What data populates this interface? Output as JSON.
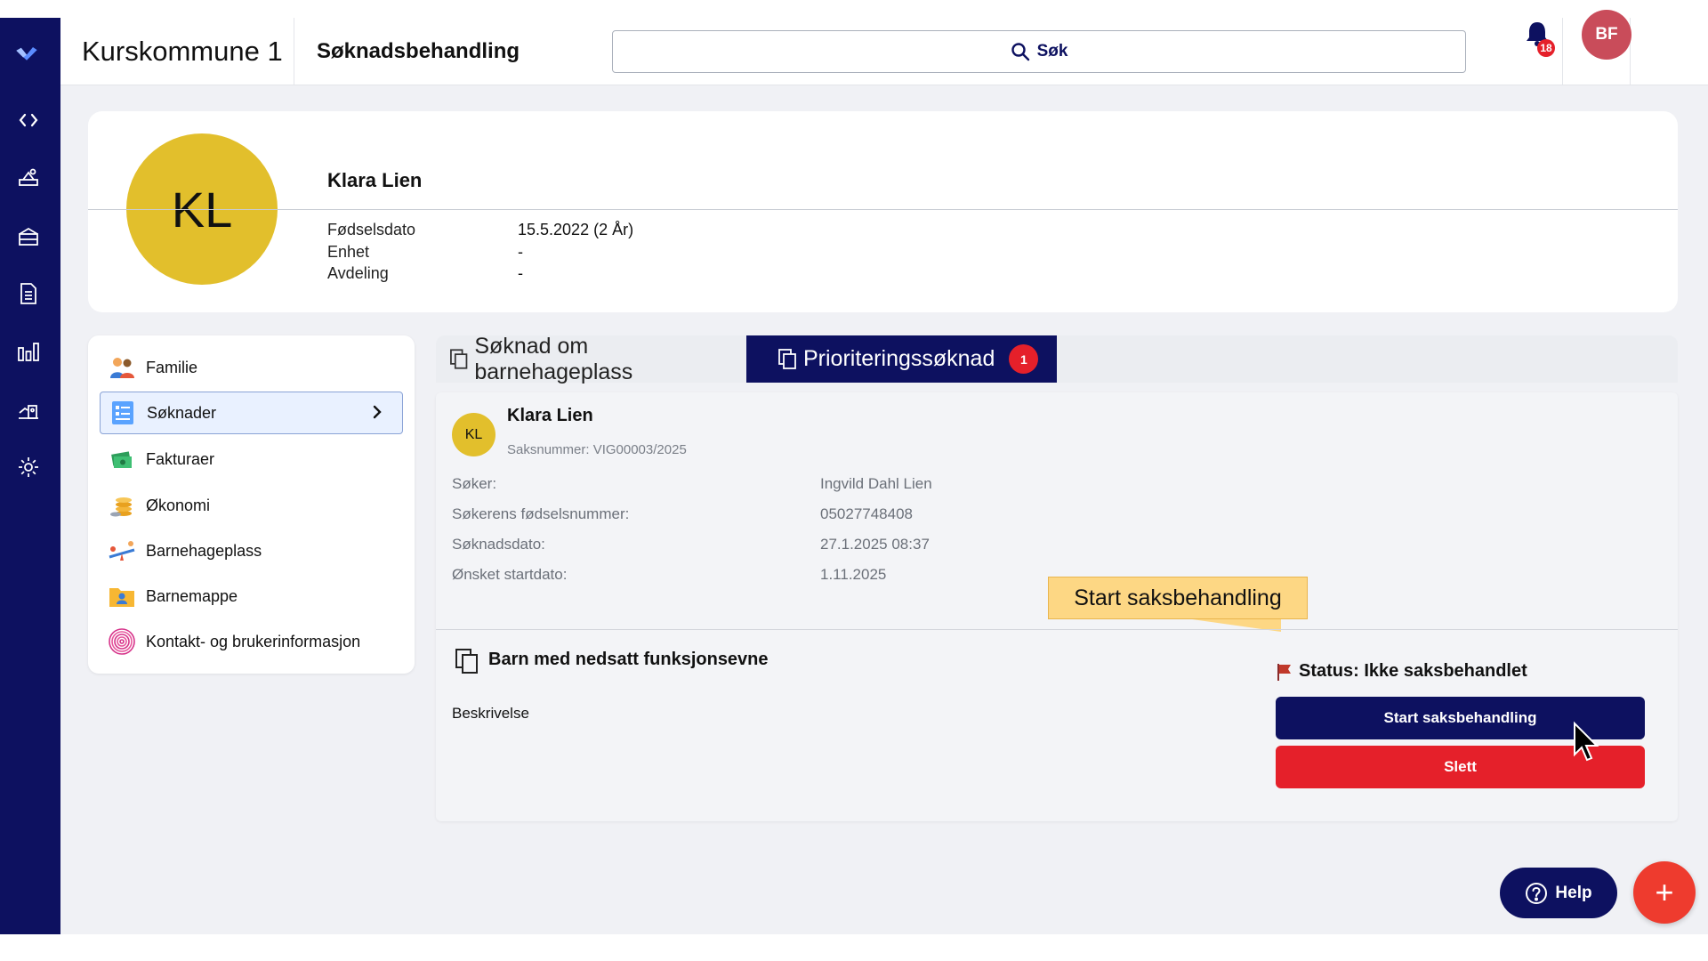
{
  "app": {
    "title": "Kurskommune 1",
    "page_title": "Søknadsbehandling"
  },
  "search": {
    "label": "Søk"
  },
  "notifications": {
    "count": "18"
  },
  "user": {
    "initials": "BF"
  },
  "profile": {
    "initials": "KL",
    "name": "Klara Lien",
    "fields": [
      {
        "label": "Fødselsdato",
        "value": "15.5.2022 (2 År)"
      },
      {
        "label": "Enhet",
        "value": "-"
      },
      {
        "label": "Avdeling",
        "value": "-"
      }
    ]
  },
  "menu": {
    "items": [
      {
        "label": "Familie",
        "icon": "family-icon"
      },
      {
        "label": "Søknader",
        "icon": "applications-icon",
        "active": true
      },
      {
        "label": "Fakturaer",
        "icon": "invoice-icon"
      },
      {
        "label": "Økonomi",
        "icon": "coins-icon"
      },
      {
        "label": "Barnehageplass",
        "icon": "seesaw-icon"
      },
      {
        "label": "Barnemappe",
        "icon": "folder-child-icon"
      },
      {
        "label": "Kontakt- og brukerinformasjon",
        "icon": "fingerprint-icon"
      }
    ]
  },
  "tabs": [
    {
      "label": "Søknad om barnehageplass"
    },
    {
      "label": "Prioriteringssøknad",
      "badge": "1",
      "active": true
    }
  ],
  "application": {
    "initials": "KL",
    "name": "Klara Lien",
    "case_number": "Saksnummer: VIG00003/2025",
    "details": [
      {
        "label": "Søker:",
        "value": "Ingvild Dahl Lien"
      },
      {
        "label": "Søkerens fødselsnummer:",
        "value": "05027748408"
      },
      {
        "label": "Søknadsdato:",
        "value": "27.1.2025 08:37"
      },
      {
        "label": "Ønsket startdato:",
        "value": "1.11.2025"
      }
    ],
    "section_title": "Barn med nedsatt funksjonsevne",
    "section_desc": "Beskrivelse",
    "status": "Status: Ikke saksbehandlet",
    "start_button": "Start saksbehandling",
    "delete_button": "Slett"
  },
  "tooltip": {
    "text": "Start saksbehandling"
  },
  "help": {
    "label": "Help"
  },
  "fab": {
    "label": "+"
  },
  "colors": {
    "brand": "#0d1160",
    "danger": "#e5202a",
    "avatar_child": "#e2bf2c",
    "avatar_user": "#c94c5a",
    "tooltip": "#fdd784"
  }
}
